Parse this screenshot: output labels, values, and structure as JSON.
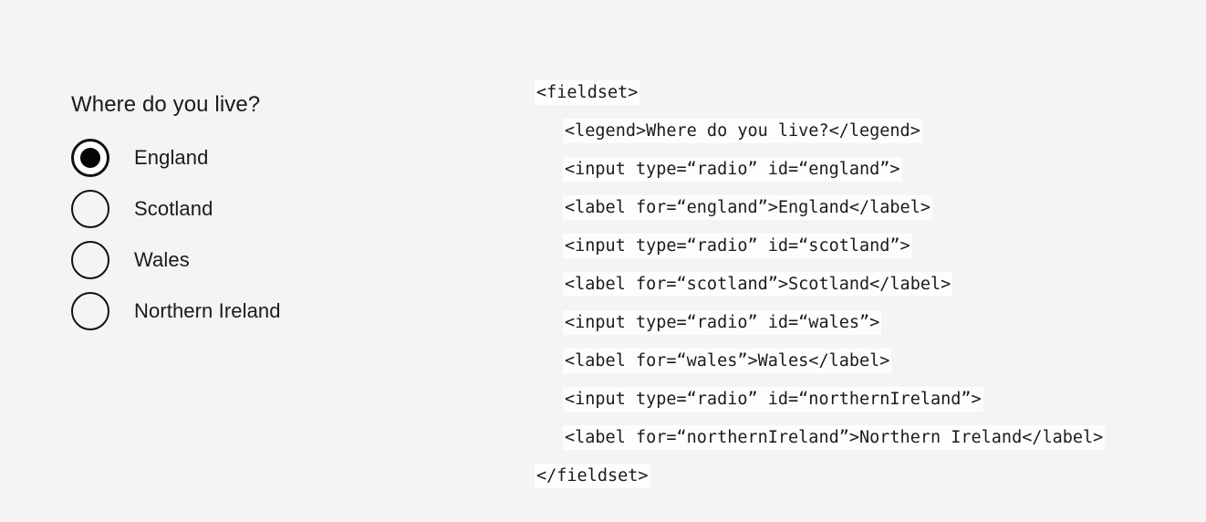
{
  "page": {
    "background_color": "#f4f4f4",
    "text_color": "#1a1a1a"
  },
  "form": {
    "legend": "Where do you live?",
    "options": [
      {
        "label": "England",
        "id": "england",
        "selected": true
      },
      {
        "label": "Scotland",
        "id": "scotland",
        "selected": false
      },
      {
        "label": "Wales",
        "id": "wales",
        "selected": false
      },
      {
        "label": "Northern Ireland",
        "id": "northernIreland",
        "selected": false
      }
    ]
  },
  "code": {
    "highlight_color": "#fdfdfd",
    "lines": [
      {
        "text": "<fieldset>",
        "indent": 0
      },
      {
        "text": "<legend>Where do you live?</legend>",
        "indent": 1
      },
      {
        "text": "<input type=“radio” id=“england”>",
        "indent": 1
      },
      {
        "text": "<label for=“england”>England</label>",
        "indent": 1
      },
      {
        "text": "<input type=“radio” id=“scotland”>",
        "indent": 1
      },
      {
        "text": "<label for=“scotland”>Scotland</label>",
        "indent": 1
      },
      {
        "text": "<input type=“radio” id=“wales”>",
        "indent": 1
      },
      {
        "text": "<label for=“wales”>Wales</label>",
        "indent": 1
      },
      {
        "text": "<input type=“radio” id=“northernIreland”>",
        "indent": 1
      },
      {
        "text": "<label for=“northernIreland”>Northern Ireland</label>",
        "indent": 1
      },
      {
        "text": "</fieldset>",
        "indent": 0
      }
    ]
  }
}
